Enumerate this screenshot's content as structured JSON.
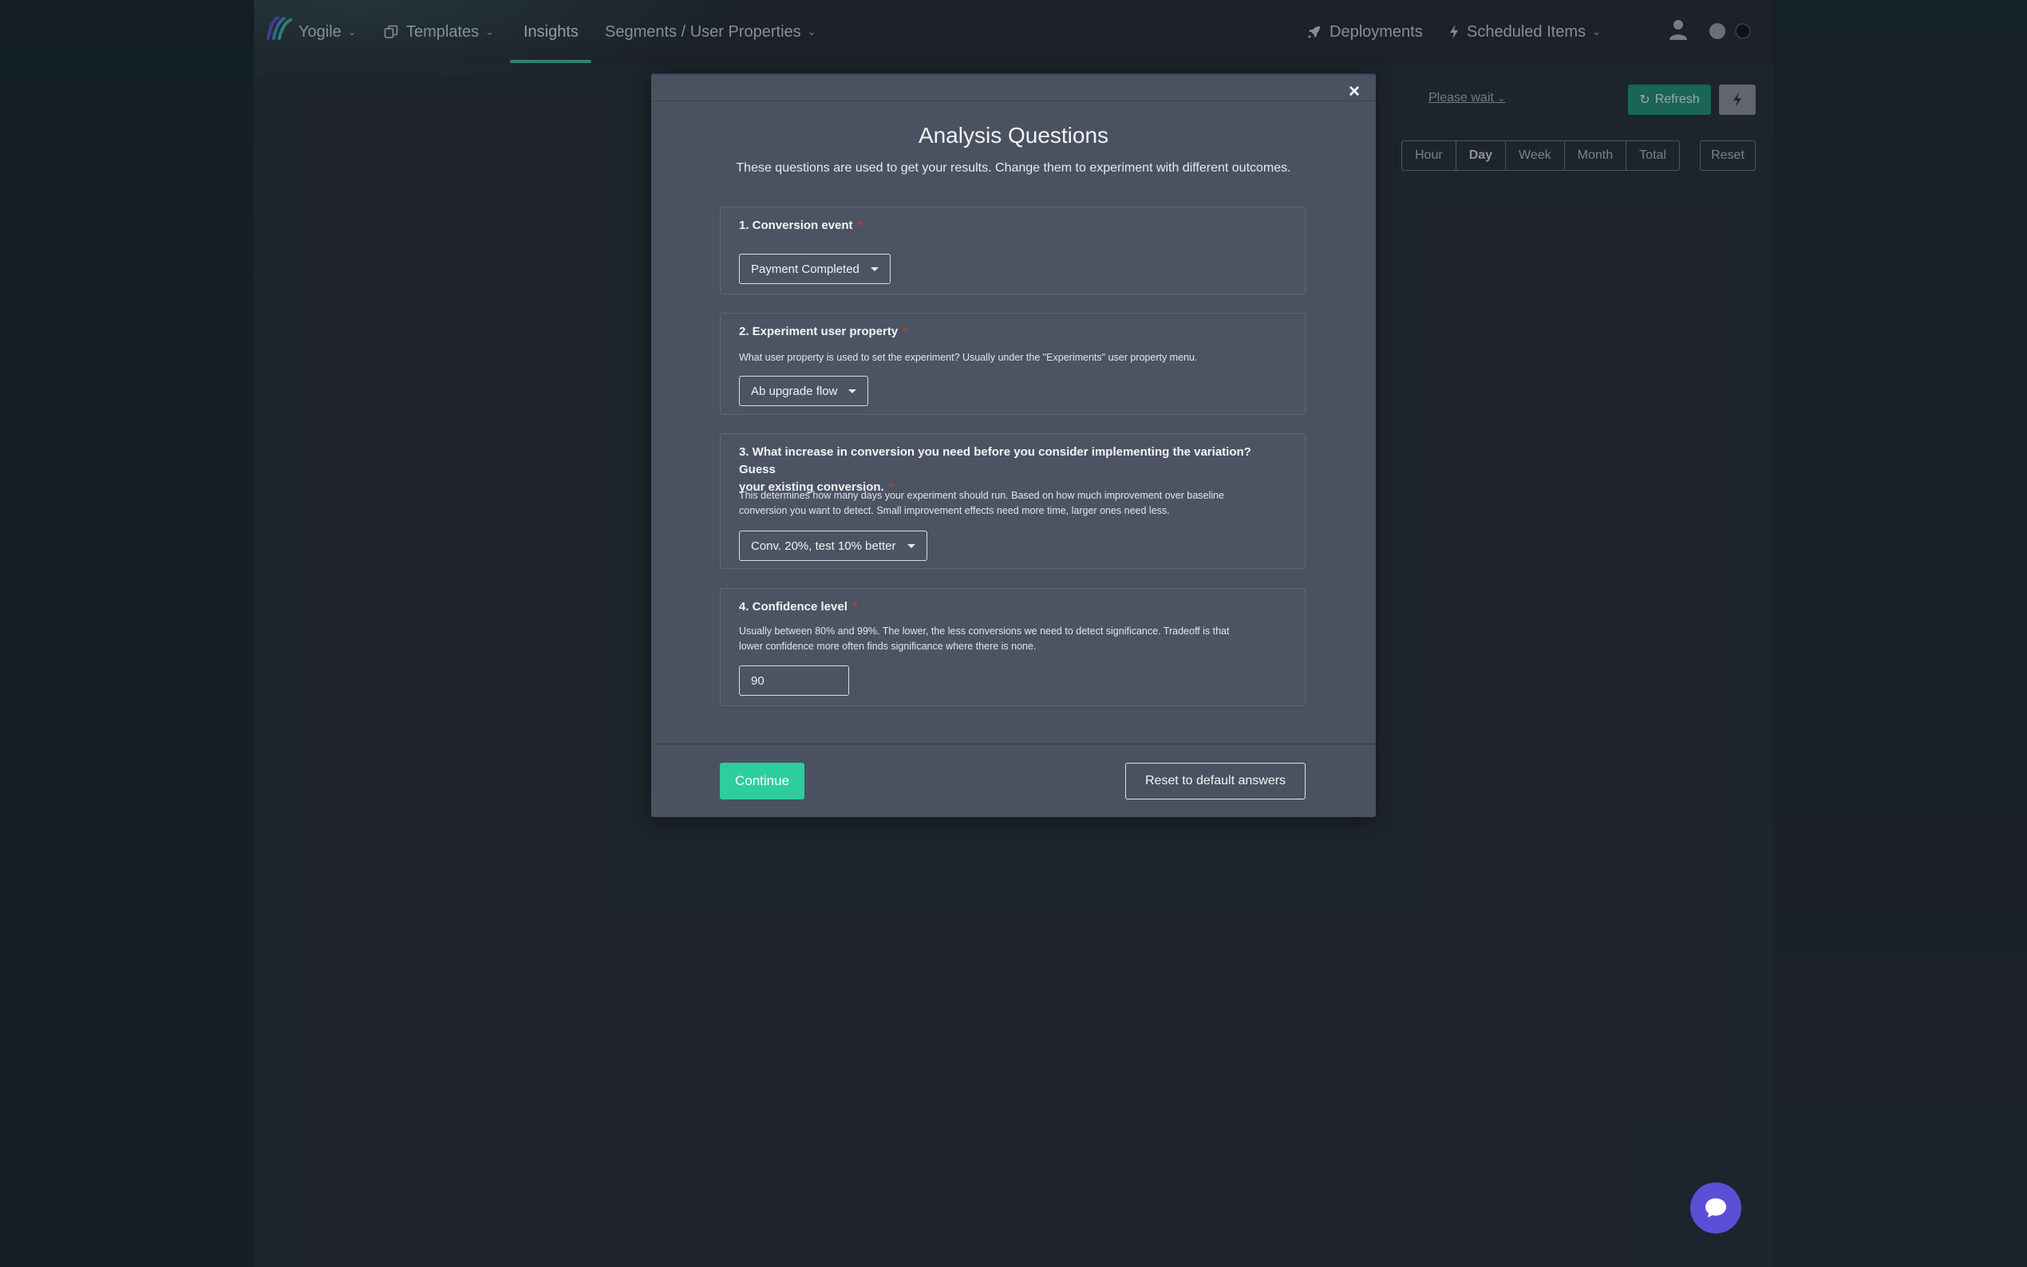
{
  "nav": {
    "brand": "Yogile",
    "templates": "Templates",
    "insights": "Insights",
    "segments": "Segments / User Properties",
    "deployments": "Deployments",
    "scheduled": "Scheduled Items"
  },
  "toolbar": {
    "please_wait": "Please wait",
    "refresh": "Refresh",
    "ranges": [
      "Hour",
      "Day",
      "Week",
      "Month",
      "Total"
    ],
    "active_range": "Day",
    "reset": "Reset"
  },
  "modal": {
    "close": "×",
    "title": "Analysis Questions",
    "subtitle": "These questions are used to get your results. Change them to experiment with different outcomes.",
    "questions": [
      {
        "title": "1. Conversion event",
        "required": "*",
        "value": "Payment Completed"
      },
      {
        "title": "2. Experiment user property",
        "required": "*",
        "description": "What user property is used to set the experiment? Usually under the \"Experiments\" user property menu.",
        "value": "Ab upgrade flow"
      },
      {
        "title_line1": "3. What increase in conversion you need before you consider implementing the variation? Guess",
        "title_line2": "your existing conversion.",
        "required": "*",
        "description_line1": "This determines how many days your experiment should run. Based on how much improvement over baseline",
        "description_line2": "conversion you want to detect. Small improvement effects need more time, larger ones need less.",
        "value": "Conv. 20%, test 10% better"
      },
      {
        "title": "4. Confidence level",
        "required": "*",
        "description_line1": "Usually between 80% and 99%. The lower, the less conversions we need to detect significance. Tradeoff is that",
        "description_line2": "lower confidence more often finds significance where there is none.",
        "value": "90"
      }
    ],
    "continue": "Continue",
    "reset_default": "Reset to default answers"
  },
  "colors": {
    "accent": "#2ccf9c",
    "required": "#c0392b",
    "chat": "#5b4fd8",
    "refresh": "#1f8f74"
  }
}
